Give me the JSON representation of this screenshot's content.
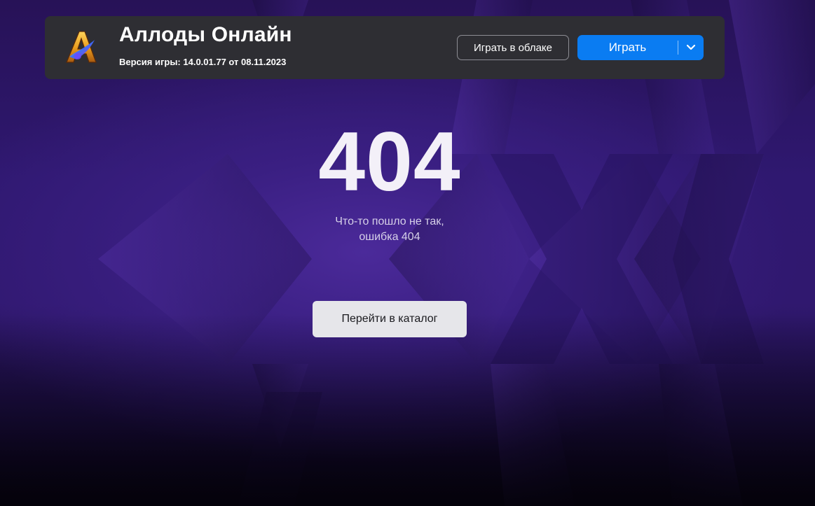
{
  "header": {
    "title": "Аллоды Онлайн",
    "version": "Версия игры: 14.0.01.77 от 08.11.2023",
    "cloud_button": "Играть в облаке",
    "play_button": "Играть",
    "logo_icon": "allods-logo-icon",
    "dropdown_icon": "chevron-down-icon"
  },
  "error": {
    "code": "404",
    "message_line1": "Что-то пошло не так,",
    "message_line2": "ошибка 404",
    "catalog_button": "Перейти в каталог"
  },
  "colors": {
    "background": "#2a1660",
    "header_bg": "#2e2e33",
    "play_button": "#0a7cf2",
    "catalog_button": "#e6e6ea"
  }
}
